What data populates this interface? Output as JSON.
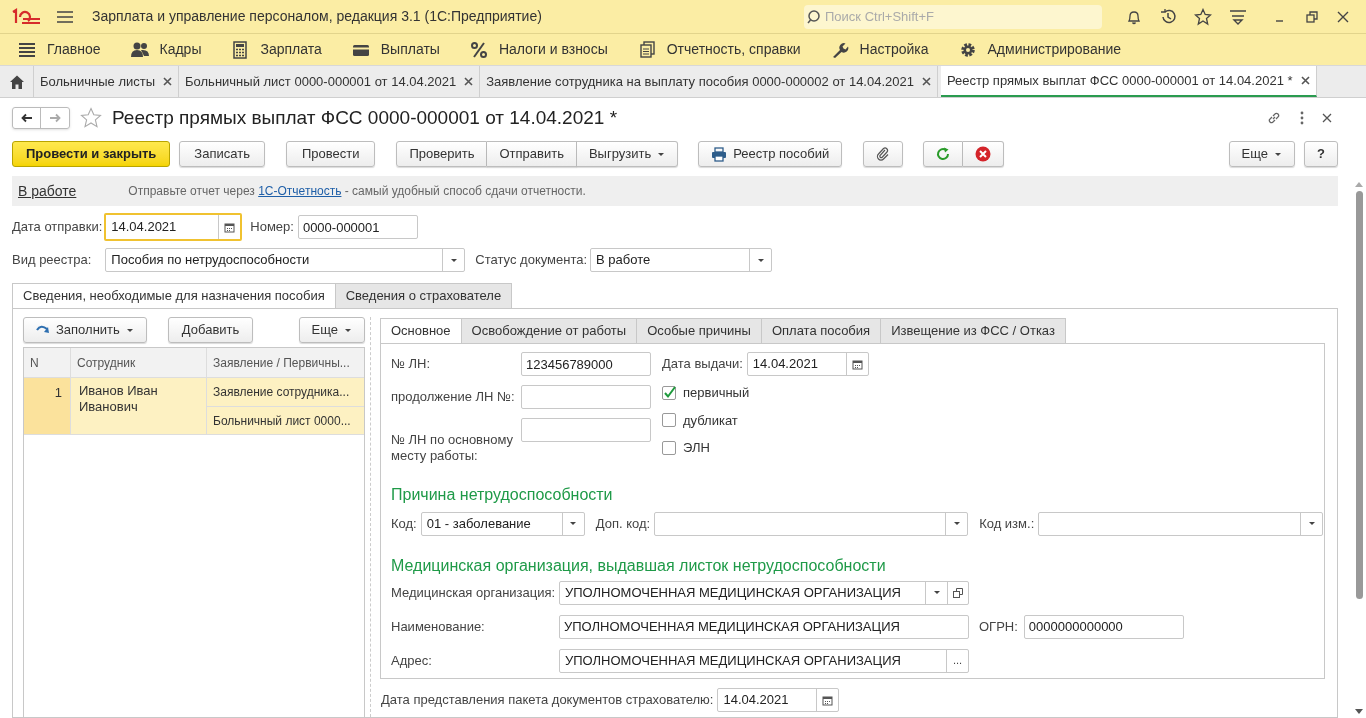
{
  "app": {
    "title": "Зарплата и управление персоналом, редакция 3.1  (1С:Предприятие)",
    "search_placeholder": "Поиск Ctrl+Shift+F"
  },
  "sections": [
    "Главное",
    "Кадры",
    "Зарплата",
    "Выплаты",
    "Налоги и взносы",
    "Отчетность, справки",
    "Настройка",
    "Администрирование"
  ],
  "open_tabs": [
    {
      "label": "Больничные листы",
      "selected": false
    },
    {
      "label": "Больничный лист 0000-000001 от 14.04.2021",
      "selected": false
    },
    {
      "label": "Заявление сотрудника на выплату пособия 0000-000002 от 14.04.2021",
      "selected": false
    },
    {
      "label": "Реестр прямых выплат ФСС 0000-000001 от 14.04.2021 *",
      "selected": true
    }
  ],
  "document": {
    "title": "Реестр прямых выплат ФСС 0000-000001 от 14.04.2021 *",
    "toolbar": {
      "post_close": "Провести и закрыть",
      "save": "Записать",
      "post": "Провести",
      "check": "Проверить",
      "send": "Отправить",
      "export": "Выгрузить",
      "print": "Реестр пособий",
      "more": "Еще",
      "help": "?"
    },
    "status_link": "В работе",
    "notice": {
      "before": "Отправьте отчет через ",
      "link": "1С-Отчетность",
      "after": " - самый удобный способ сдачи отчетности."
    },
    "send_date": {
      "label": "Дата отправки:",
      "value": "14.04.2021"
    },
    "number": {
      "label": "Номер:",
      "value": "0000-000001"
    },
    "registry_type": {
      "label": "Вид реестра:",
      "value": "Пособия по нетрудоспособности"
    },
    "doc_status": {
      "label": "Статус документа:",
      "value": "В работе"
    }
  },
  "outer_tabs": [
    {
      "label": "Сведения, необходимые для назначения пособия",
      "selected": true
    },
    {
      "label": "Сведения о страхователе",
      "selected": false
    }
  ],
  "table": {
    "toolbar": {
      "fill": "Заполнить",
      "add": "Добавить",
      "more": "Еще"
    },
    "columns": [
      "N",
      "Сотрудник",
      "Заявление / Первичны..."
    ],
    "rows": [
      {
        "n": "1",
        "employee": "Иванов Иван Иванович",
        "documents": [
          "Заявление сотрудника...",
          "Больничный лист 0000..."
        ],
        "selected": true
      }
    ]
  },
  "inner_tabs": [
    {
      "label": "Основное",
      "selected": true
    },
    {
      "label": "Освобождение от работы",
      "selected": false
    },
    {
      "label": "Особые причины",
      "selected": false
    },
    {
      "label": "Оплата пособия",
      "selected": false
    },
    {
      "label": "Извещение из ФСС / Отказ",
      "selected": false
    }
  ],
  "form": {
    "ln_number": {
      "label": "№ ЛН:",
      "value": "123456789000"
    },
    "continuation": {
      "label": "продолжение ЛН №:"
    },
    "main_job_ln": {
      "label": "№ ЛН по основному месту работы:"
    },
    "issue_date": {
      "label": "Дата выдачи:",
      "value": "14.04.2021"
    },
    "checkboxes": [
      {
        "label": "первичный",
        "checked": true
      },
      {
        "label": "дубликат",
        "checked": false
      },
      {
        "label": "ЭЛН",
        "checked": false
      }
    ],
    "reason_heading": "Причина нетрудоспособности",
    "code": {
      "label": "Код:",
      "value": "01 - заболевание"
    },
    "extra_code": {
      "label": "Доп. код:"
    },
    "change_code": {
      "label": "Код изм.:"
    },
    "med_heading": "Медицинская организация, выдавшая листок нетрудоспособности",
    "med_org": {
      "label": "Медицинская организация:",
      "value": "УПОЛНОМОЧЕННАЯ МЕДИЦИНСКАЯ ОРГАНИЗАЦИЯ"
    },
    "name": {
      "label": "Наименование:",
      "value": "УПОЛНОМОЧЕННАЯ МЕДИЦИНСКАЯ ОРГАНИЗАЦИЯ"
    },
    "ogrn": {
      "label": "ОГРН:",
      "value": "0000000000000"
    },
    "address": {
      "label": "Адрес:",
      "value": "УПОЛНОМОЧЕННАЯ МЕДИЦИНСКАЯ ОРГАНИЗАЦИЯ",
      "more": "..."
    }
  },
  "package_date": {
    "label": "Дата представления пакета документов страхователю:",
    "value": "14.04.2021"
  }
}
